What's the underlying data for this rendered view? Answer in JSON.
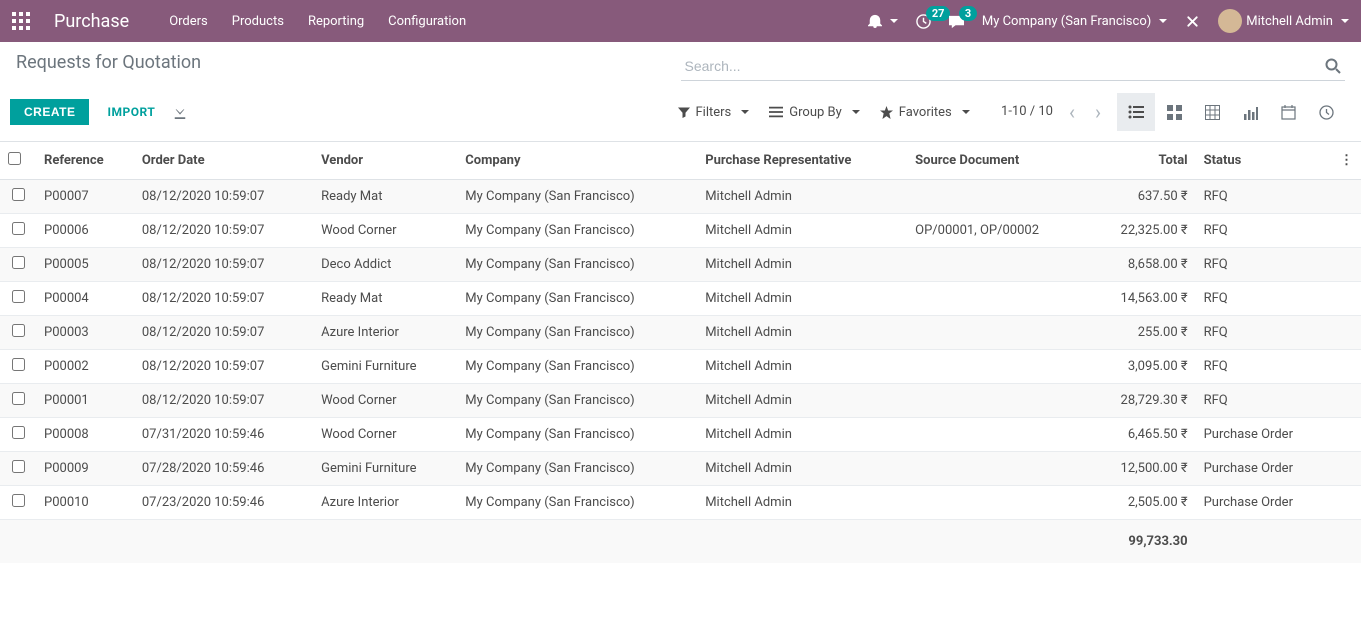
{
  "navbar": {
    "brand": "Purchase",
    "menu": [
      "Orders",
      "Products",
      "Reporting",
      "Configuration"
    ],
    "notif_badge": "27",
    "msg_badge": "3",
    "company": "My Company (San Francisco)",
    "user": "Mitchell Admin"
  },
  "breadcrumb": "Requests for Quotation",
  "search": {
    "placeholder": "Search..."
  },
  "buttons": {
    "create": "CREATE",
    "import": "IMPORT"
  },
  "search_options": {
    "filters": "Filters",
    "groupby": "Group By",
    "favorites": "Favorites"
  },
  "pager": {
    "range": "1-10 / 10"
  },
  "columns": {
    "reference": "Reference",
    "order_date": "Order Date",
    "vendor": "Vendor",
    "company": "Company",
    "rep": "Purchase Representative",
    "source": "Source Document",
    "total": "Total",
    "status": "Status"
  },
  "rows": [
    {
      "reference": "P00007",
      "order_date": "08/12/2020 10:59:07",
      "vendor": "Ready Mat",
      "company": "My Company (San Francisco)",
      "rep": "Mitchell Admin",
      "source": "",
      "total": "637.50 ₹",
      "status": "RFQ"
    },
    {
      "reference": "P00006",
      "order_date": "08/12/2020 10:59:07",
      "vendor": "Wood Corner",
      "company": "My Company (San Francisco)",
      "rep": "Mitchell Admin",
      "source": "OP/00001, OP/00002",
      "total": "22,325.00 ₹",
      "status": "RFQ"
    },
    {
      "reference": "P00005",
      "order_date": "08/12/2020 10:59:07",
      "vendor": "Deco Addict",
      "company": "My Company (San Francisco)",
      "rep": "Mitchell Admin",
      "source": "",
      "total": "8,658.00 ₹",
      "status": "RFQ"
    },
    {
      "reference": "P00004",
      "order_date": "08/12/2020 10:59:07",
      "vendor": "Ready Mat",
      "company": "My Company (San Francisco)",
      "rep": "Mitchell Admin",
      "source": "",
      "total": "14,563.00 ₹",
      "status": "RFQ"
    },
    {
      "reference": "P00003",
      "order_date": "08/12/2020 10:59:07",
      "vendor": "Azure Interior",
      "company": "My Company (San Francisco)",
      "rep": "Mitchell Admin",
      "source": "",
      "total": "255.00 ₹",
      "status": "RFQ"
    },
    {
      "reference": "P00002",
      "order_date": "08/12/2020 10:59:07",
      "vendor": "Gemini Furniture",
      "company": "My Company (San Francisco)",
      "rep": "Mitchell Admin",
      "source": "",
      "total": "3,095.00 ₹",
      "status": "RFQ"
    },
    {
      "reference": "P00001",
      "order_date": "08/12/2020 10:59:07",
      "vendor": "Wood Corner",
      "company": "My Company (San Francisco)",
      "rep": "Mitchell Admin",
      "source": "",
      "total": "28,729.30 ₹",
      "status": "RFQ"
    },
    {
      "reference": "P00008",
      "order_date": "07/31/2020 10:59:46",
      "vendor": "Wood Corner",
      "company": "My Company (San Francisco)",
      "rep": "Mitchell Admin",
      "source": "",
      "total": "6,465.50 ₹",
      "status": "Purchase Order"
    },
    {
      "reference": "P00009",
      "order_date": "07/28/2020 10:59:46",
      "vendor": "Gemini Furniture",
      "company": "My Company (San Francisco)",
      "rep": "Mitchell Admin",
      "source": "",
      "total": "12,500.00 ₹",
      "status": "Purchase Order"
    },
    {
      "reference": "P00010",
      "order_date": "07/23/2020 10:59:46",
      "vendor": "Azure Interior",
      "company": "My Company (San Francisco)",
      "rep": "Mitchell Admin",
      "source": "",
      "total": "2,505.00 ₹",
      "status": "Purchase Order"
    }
  ],
  "footer": {
    "total": "99,733.30"
  }
}
